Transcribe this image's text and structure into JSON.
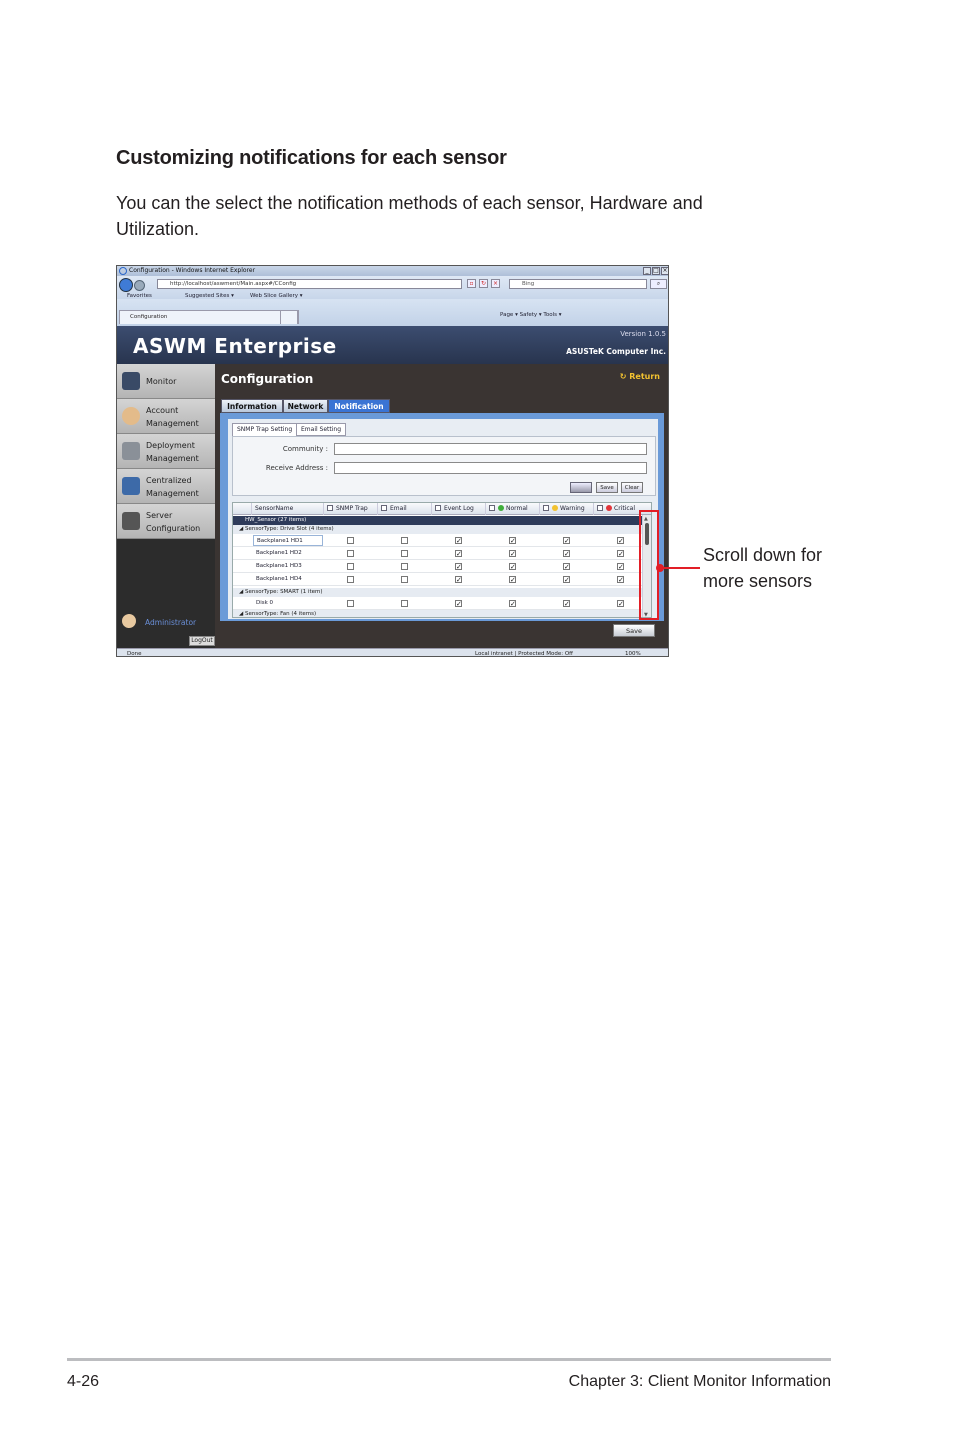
{
  "heading": "Customizing notifications for each sensor",
  "intro": "You can the select the notification methods of each sensor, Hardware and Utilization.",
  "callout": "Scroll down for\nmore sensors",
  "footer": {
    "page": "4-26",
    "chapter": "Chapter 3: Client Monitor Information"
  },
  "screenshot": {
    "browser": {
      "window_title": "Configuration - Windows Internet Explorer",
      "address": "http://localhost/aswment/Main.aspx#/CConfig",
      "search_placeholder": "Bing",
      "favorites": "Favorites",
      "suggested_sites": "Suggested Sites ▾",
      "web_slice": "Web Slice Gallery ▾",
      "tab_title": "Configuration",
      "command_bar": "Page ▾   Safety ▾   Tools ▾",
      "status_left": "Done",
      "status_zone": "Local intranet | Protected Mode: Off",
      "zoom": "100%"
    },
    "app": {
      "brand": "ASWM Enterprise",
      "version": "Version 1.0.5",
      "company": "ASUSTeK Computer Inc.",
      "sidebar": [
        {
          "label": "Monitor"
        },
        {
          "label": "Account\nManagement"
        },
        {
          "label": "Deployment\nManagement"
        },
        {
          "label": "Centralized\nManagement"
        },
        {
          "label": "Server\nConfiguration"
        }
      ],
      "admin": "Administrator",
      "logout": "LogOut",
      "page_title": "Configuration",
      "return_label": "Return",
      "tabs": [
        "Information",
        "Network",
        "Notification"
      ],
      "subtabs": [
        "SNMP Trap Setting",
        "Email Setting"
      ],
      "form": {
        "community_label": "Community :",
        "receive_label": "Receive Address :",
        "save_label": "Save",
        "clear_label": "Clear"
      },
      "table": {
        "columns": [
          "SensorName",
          "SNMP Trap",
          "Email",
          "Event Log",
          "Normal",
          "Warning",
          "Critical"
        ],
        "group_all": "HW_Sensor  (27 items)",
        "group_drive": "SensorType: Drive Slot (4 items)",
        "group_smart": "SensorType: SMART (1 item)",
        "group_fan": "SensorType: Fan (4 items)",
        "rows": [
          {
            "name": "Backplane1 HD1",
            "checks": [
              false,
              false,
              true,
              true,
              true,
              true
            ]
          },
          {
            "name": "Backplane1 HD2",
            "checks": [
              false,
              false,
              true,
              true,
              true,
              true
            ]
          },
          {
            "name": "Backplane1 HD3",
            "checks": [
              false,
              false,
              true,
              true,
              true,
              true
            ]
          },
          {
            "name": "Backplane1 HD4",
            "checks": [
              false,
              false,
              true,
              true,
              true,
              true
            ]
          },
          {
            "name": "Disk 0",
            "checks": [
              false,
              false,
              true,
              true,
              true,
              true
            ]
          }
        ]
      },
      "bottom_save": "Save",
      "colors": {
        "normal": "#3fae3a",
        "warning": "#f2c230",
        "critical": "#e2353a",
        "accent": "#3a74d4"
      }
    }
  }
}
